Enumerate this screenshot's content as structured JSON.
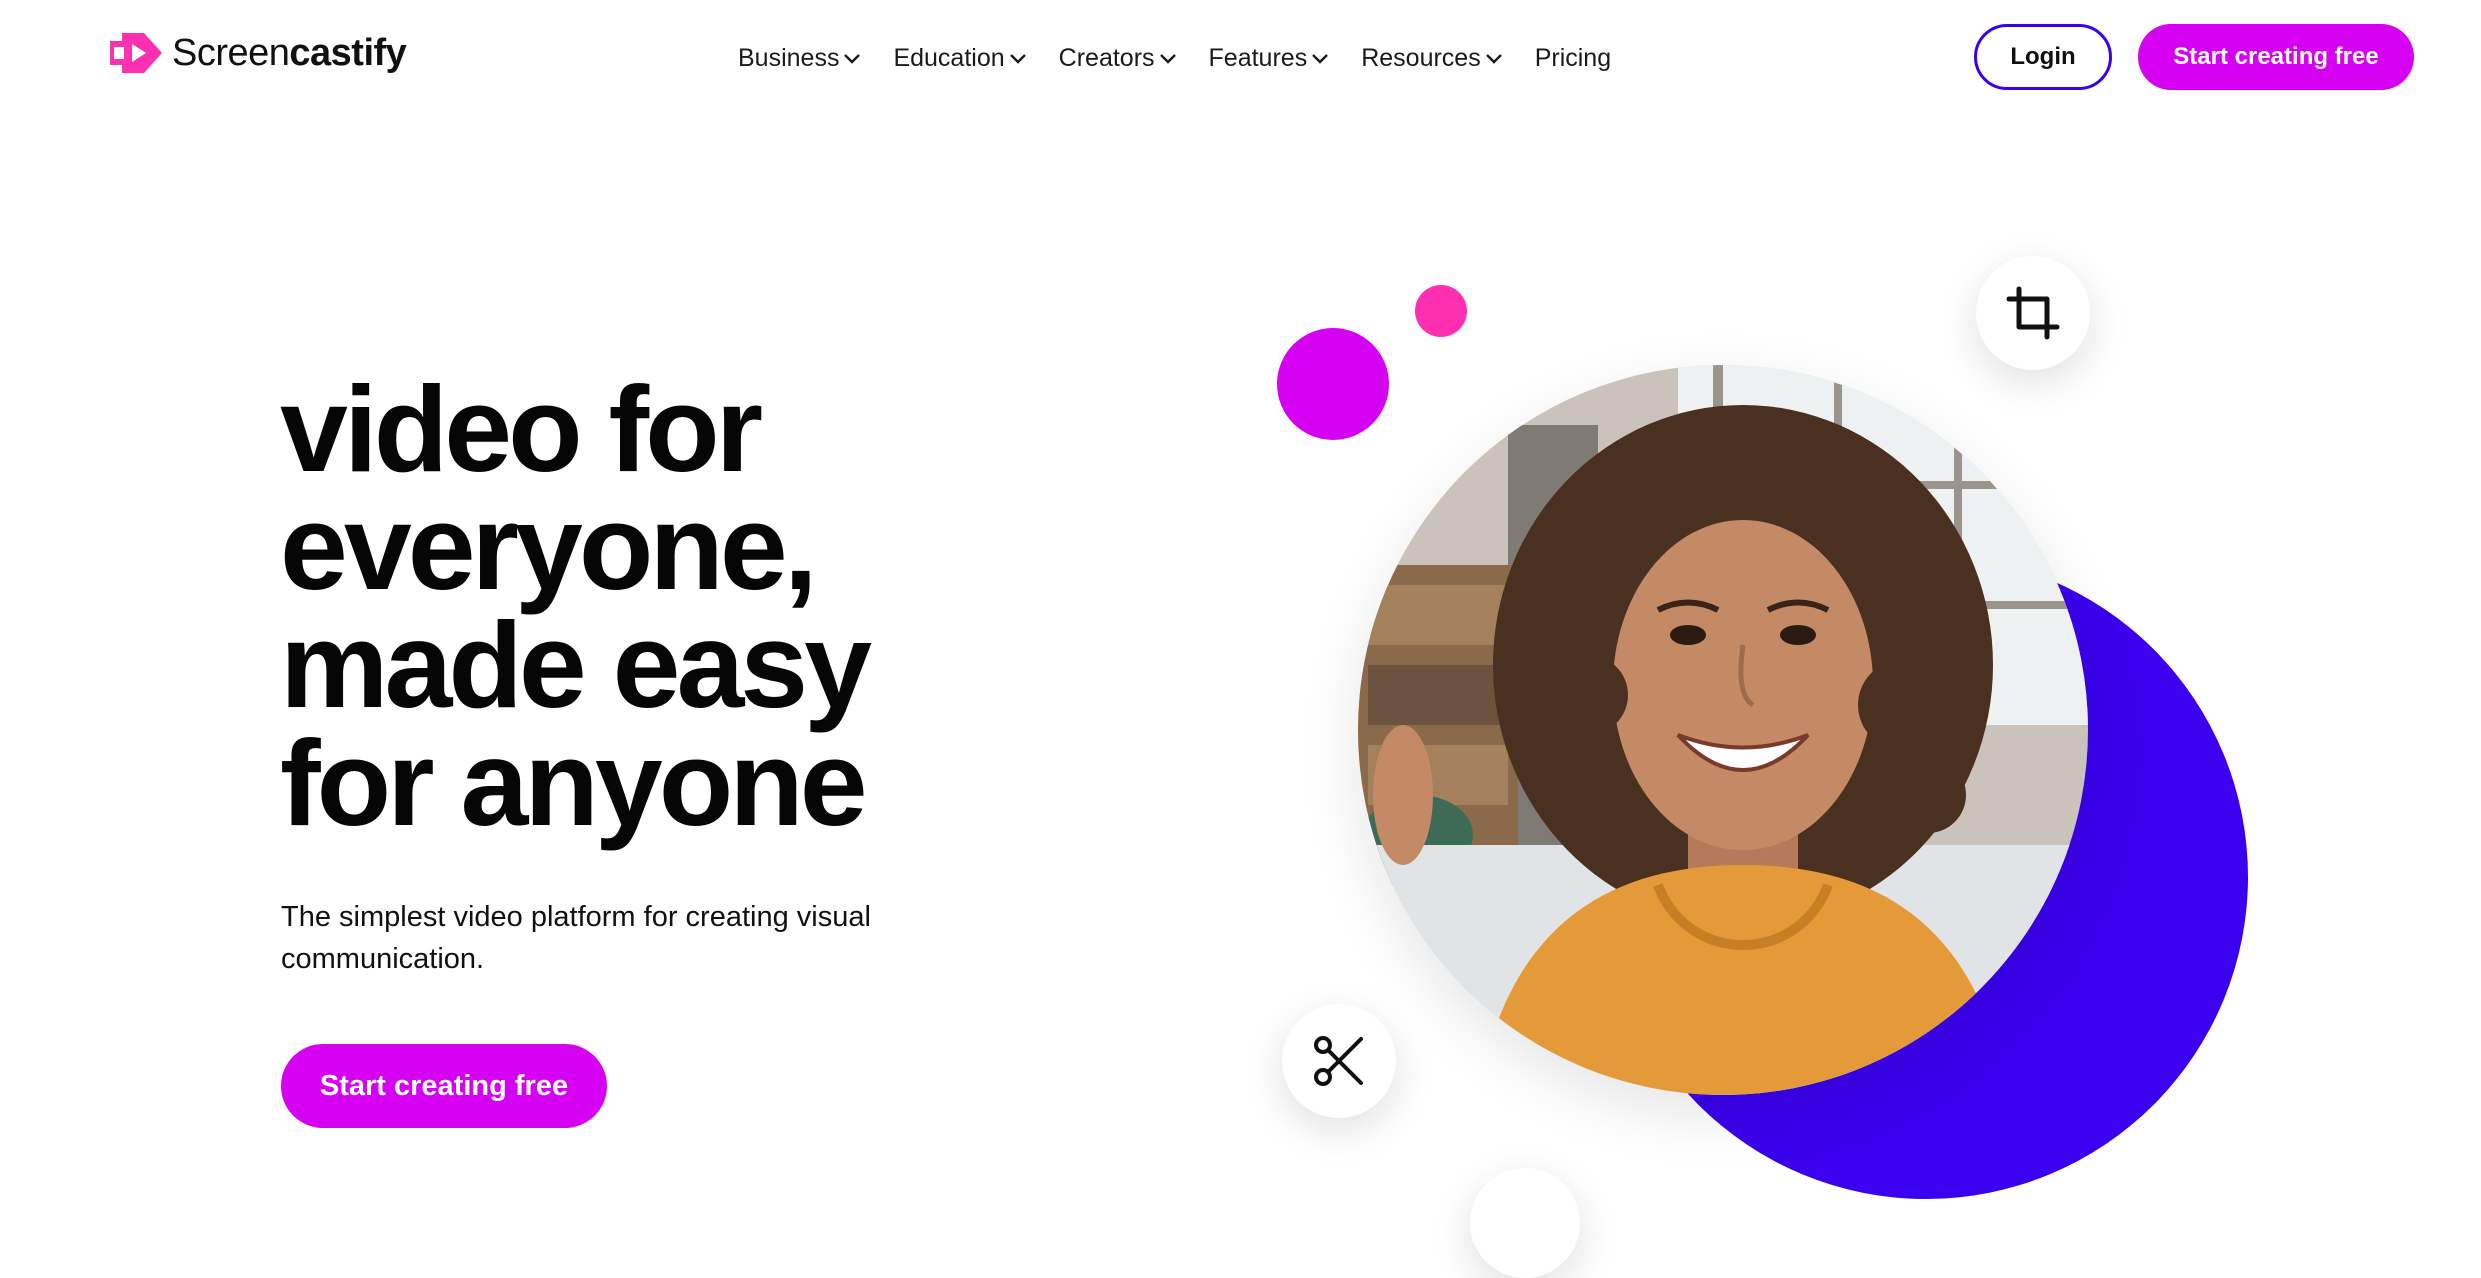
{
  "brand": {
    "name_light": "Screen",
    "name_bold": "castify",
    "accent": "#d600f2",
    "secondary": "#3b00ed",
    "logo_color": "#ff2fb2"
  },
  "nav": {
    "items": [
      {
        "label": "Business",
        "has_dropdown": true
      },
      {
        "label": "Education",
        "has_dropdown": true
      },
      {
        "label": "Creators",
        "has_dropdown": true
      },
      {
        "label": "Features",
        "has_dropdown": true
      },
      {
        "label": "Resources",
        "has_dropdown": true
      },
      {
        "label": "Pricing",
        "has_dropdown": false
      }
    ],
    "login_label": "Login",
    "cta_label": "Start creating free"
  },
  "hero": {
    "title_lines": [
      "video for",
      "everyone,",
      "made easy",
      "for anyone"
    ],
    "subtitle": "The simplest video platform for creating visual communication.",
    "cta_label": "Start creating free"
  },
  "art": {
    "icons": [
      "crop-icon",
      "scissors-icon"
    ]
  }
}
